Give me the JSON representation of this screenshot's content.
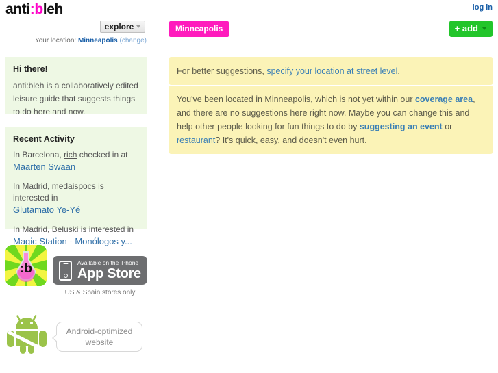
{
  "header": {
    "logo_pre": "anti",
    "logo_mark": ":b",
    "logo_post": "leh",
    "login_label": "log in",
    "explore_label": "explore",
    "city_tag": "Minneapolis",
    "add_label": "+ add",
    "location_prefix": "Your location:",
    "location_city": "Minneapolis",
    "location_change": "(change)"
  },
  "sidebar": {
    "about": {
      "heading": "Hi there!",
      "body": "anti:bleh is a collaboratively edited leisure guide that suggests things to do here and now."
    },
    "activity": {
      "heading": "Recent Activity",
      "items": [
        {
          "prefix": "In Barcelona,",
          "user": "rich",
          "verb": "checked in at",
          "title": "Maarten Swaan"
        },
        {
          "prefix": "In Madrid,",
          "user": "medaispocs",
          "verb": "is interested in",
          "title": "Glutamato Ye-Yé"
        },
        {
          "prefix": "In Madrid,",
          "user": "Beluski",
          "verb": "is interested in",
          "title": "Magic Station - Monólogos y..."
        }
      ]
    },
    "stores": {
      "app_icon_label": ":b",
      "appstore_small": "Available on the iPhone",
      "appstore_big": "App Store",
      "store_note": "US & Spain stores only",
      "android_bubble": "Android-optimized website"
    }
  },
  "main": {
    "notice_location": {
      "text_before": "For better suggestions, ",
      "link": "specify your location at street level",
      "text_after": "."
    },
    "notice_coverage": {
      "p1": "You've been located in Minneapolis, which is not yet within our ",
      "link_coverage": "coverage area",
      "p2": ", and there are no suggestions here right now. Maybe you can change this and help other people looking for fun things to do by ",
      "link_event": "suggesting an event",
      "p3": " or ",
      "link_restaurant": "restaurant",
      "p4": "? It's quick, easy, and doesn't even hurt."
    }
  },
  "colors": {
    "brand_magenta": "#ff00c8",
    "tag_magenta": "#ff1bbd",
    "add_green": "#22c52a",
    "panel_green": "#eef8e4",
    "notice_yellow": "#fbf3b7",
    "link_blue": "#3a7fb5"
  }
}
